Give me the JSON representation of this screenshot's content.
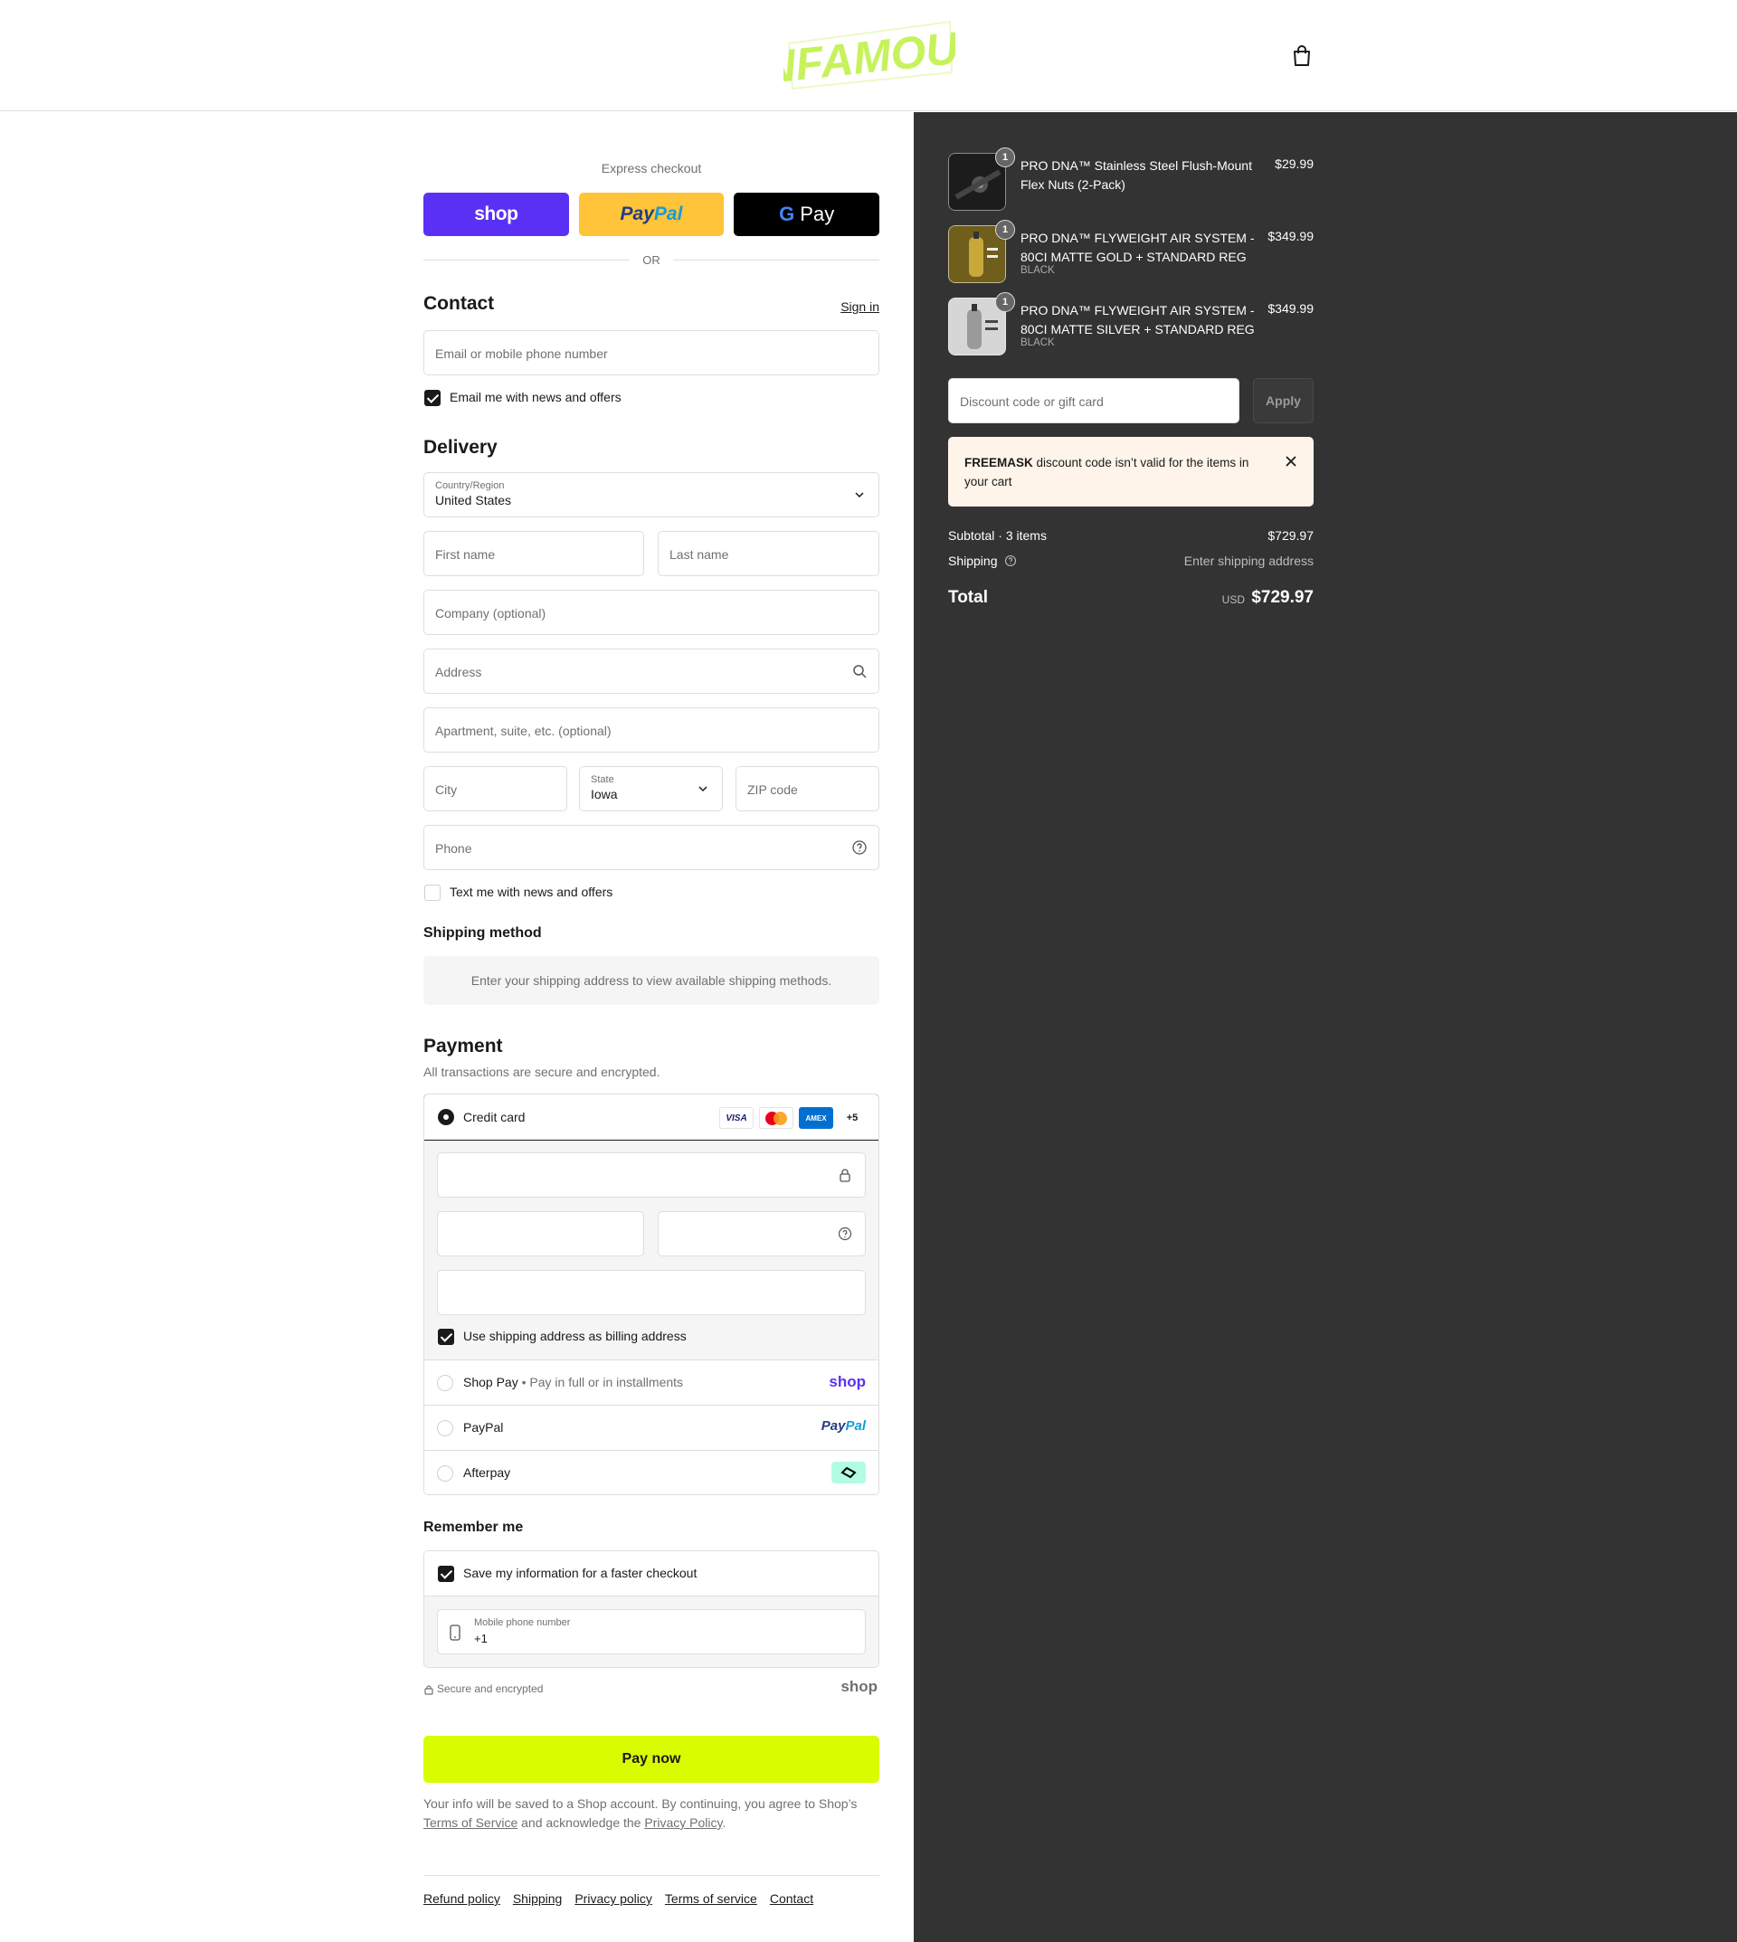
{
  "brand": {
    "logo_text": "INFAMOUS",
    "accent": "#d9fc00",
    "logo_color": "#c6f25c"
  },
  "express": {
    "title": "Express checkout",
    "shop": "shop",
    "paypal_a": "Pay",
    "paypal_b": "Pal",
    "gpay_g": "G",
    "gpay_text": "Pay",
    "or": "OR"
  },
  "contact": {
    "title": "Contact",
    "sign_in": "Sign in",
    "email_placeholder": "Email or mobile phone number",
    "email_news_label": "Email me with news and offers",
    "email_news_checked": true
  },
  "delivery": {
    "title": "Delivery",
    "country_label": "Country/Region",
    "country_value": "United States",
    "first_name": "First name",
    "last_name": "Last name",
    "company": "Company (optional)",
    "address": "Address",
    "apartment": "Apartment, suite, etc. (optional)",
    "city": "City",
    "state_label": "State",
    "state_value": "Iowa",
    "zip": "ZIP code",
    "phone": "Phone",
    "text_news_label": "Text me with news and offers",
    "text_news_checked": false
  },
  "shipping_method": {
    "title": "Shipping method",
    "message": "Enter your shipping address to view available shipping methods."
  },
  "payment": {
    "title": "Payment",
    "subtitle": "All transactions are secure and encrypted.",
    "credit_card": "Credit card",
    "card_visa": "VISA",
    "card_amex": "AMEX",
    "card_more": "+5",
    "billing_label": "Use shipping address as billing address",
    "billing_checked": true,
    "shop_pay": "Shop Pay",
    "shop_pay_sub": "Pay in full or in installments",
    "shop_brand": "shop",
    "paypal": "PayPal",
    "paypal_brand_a": "Pay",
    "paypal_brand_b": "Pal",
    "afterpay": "Afterpay"
  },
  "remember": {
    "title": "Remember me",
    "save_label": "Save my information for a faster checkout",
    "save_checked": true,
    "phone_label": "Mobile phone number",
    "phone_value": "+1",
    "secure_text": "Secure and encrypted",
    "shop_brand": "shop"
  },
  "pay_now": "Pay now",
  "legal": {
    "text_1": "Your info will be saved to a Shop account. By continuing, you agree to Shop’s ",
    "terms": "Terms of Service",
    "text_2": " and acknowledge the ",
    "privacy": "Privacy Policy",
    "text_3": "."
  },
  "footer": {
    "links": [
      "Refund policy",
      "Shipping",
      "Privacy policy",
      "Terms of service",
      "Contact"
    ]
  },
  "summary": {
    "items": [
      {
        "name": "PRO DNA™ Stainless Steel Flush-Mount Flex Nuts (2-Pack)",
        "variant": "",
        "price": "$29.99",
        "qty": "1",
        "thumb_color": "#1c1c1c"
      },
      {
        "name": "PRO DNA™ FLYWEIGHT AIR SYSTEM - 80CI MATTE GOLD + STANDARD REG",
        "variant": "BLACK",
        "price": "$349.99",
        "qty": "1",
        "thumb_color": "#8a7526"
      },
      {
        "name": "PRO DNA™ FLYWEIGHT AIR SYSTEM - 80CI MATTE SILVER + STANDARD REG",
        "variant": "BLACK",
        "price": "$349.99",
        "qty": "1",
        "thumb_color": "#cfcfcf"
      }
    ],
    "discount_placeholder": "Discount code or gift card",
    "apply": "Apply",
    "alert_code": "FREEMASK",
    "alert_text": " discount code isn’t valid for the items in your cart",
    "subtotal_label": "Subtotal · 3 items",
    "subtotal_value": "$729.97",
    "shipping_label": "Shipping",
    "shipping_value": "Enter shipping address",
    "total_label": "Total",
    "currency": "USD",
    "total_value": "$729.97"
  }
}
